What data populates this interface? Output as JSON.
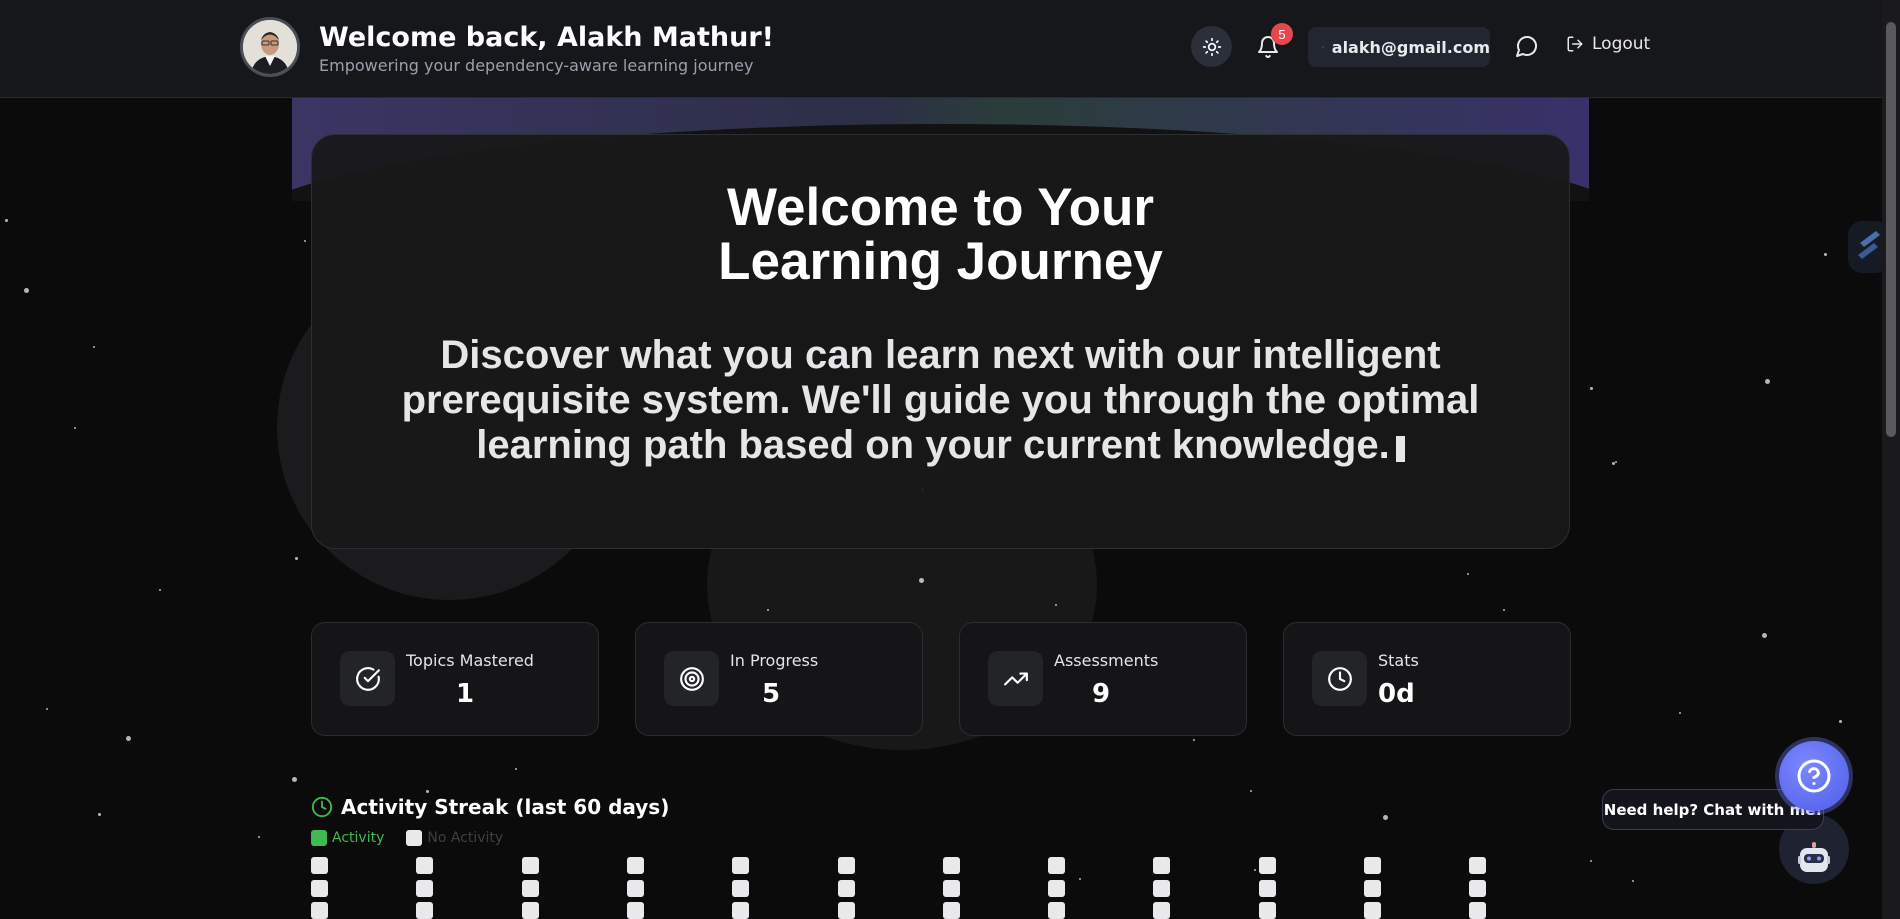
{
  "header": {
    "title": "Welcome back, Alakh Mathur!",
    "subtitle": "Empowering your dependency-aware learning journey",
    "notification_count": "5",
    "email": "alakh@gmail.com",
    "logout_label": "Logout"
  },
  "hero": {
    "title_line1": "Welcome to Your",
    "title_line2": "Learning Journey",
    "description": "Discover what you can learn next with our intelligent prerequisite system. We'll guide you through the optimal learning path based on your current knowledge."
  },
  "stats": [
    {
      "label": "Topics Mastered",
      "value": "1",
      "icon": "check-circle-icon"
    },
    {
      "label": "In Progress",
      "value": "5",
      "icon": "target-icon"
    },
    {
      "label": "Assessments",
      "value": "9",
      "icon": "trending-up-icon"
    },
    {
      "label": "Stats",
      "value": "0d",
      "icon": "clock-icon"
    }
  ],
  "activity": {
    "title": "Activity Streak (last 60 days)",
    "legend_activity": "Activity",
    "legend_no_activity": "No Activity",
    "days_total": 60,
    "colors": {
      "activity": "#3fb950",
      "no_activity": "#e9e9ec"
    }
  },
  "help": {
    "bubble_text": "Need help? Chat with me!"
  },
  "colors": {
    "background": "#0b0b0c",
    "accent_green": "#3fb950",
    "badge_red": "#e5484d",
    "help_blue": "#5b67f0"
  }
}
